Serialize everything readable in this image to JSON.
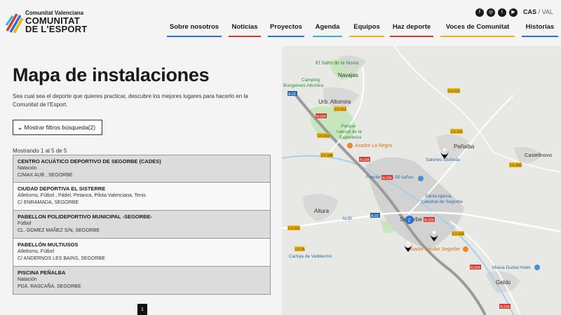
{
  "header": {
    "logo_small": "Comunitat Valenciana",
    "logo_line1": "COMUNITAT",
    "logo_line2": "DE L'ESPORT",
    "lang_active": "CAS",
    "lang_sep": "/",
    "lang_other": "VAL",
    "socials": [
      "facebook-icon",
      "instagram-icon",
      "twitter-icon",
      "youtube-icon"
    ]
  },
  "nav": [
    {
      "label": "Sobre nosotros",
      "color": "#2a6fd6"
    },
    {
      "label": "Noticias",
      "color": "#d93a2f"
    },
    {
      "label": "Proyectos",
      "color": "#2a6fd6"
    },
    {
      "label": "Agenda",
      "color": "#2fb5c9"
    },
    {
      "label": "Equipos",
      "color": "#f0b400"
    },
    {
      "label": "Haz deporte",
      "color": "#d93a2f"
    },
    {
      "label": "Voces de Comunitat",
      "color": "#f0b400"
    },
    {
      "label": "Historias",
      "color": "#2a6fd6"
    }
  ],
  "page": {
    "title": "Mapa de instalaciones",
    "intro": "Sea cual sea el deporte que quieres practicar, descubre los mejores lugares para hacerlo en la Comunitat de l'Esport.",
    "filter_label": "Mostrar filtros búsqueda(2)",
    "showing": "Mostrando 1 al 5 de 5",
    "page_number": "1"
  },
  "results": [
    {
      "name": "CENTRO ACUÁTICO DEPORTIVO DE SEGORBE (CADES)",
      "sports": "Natación",
      "address": "C/MAX AUB , SEGORBE"
    },
    {
      "name": "CIUDAD DEPORTIVA EL SISTERRE",
      "sports": "Atletismo, Fútbol , Pádel, Petanca, Pilota Valenciana, Tenis",
      "address": "C/ ENRAMADA, SEGORBE"
    },
    {
      "name": "PABELLON POLIDEPORTIVO MUNICIPAL -SEGORBE-",
      "sports": "Fútbol",
      "address": "CL. GOMEZ MAÑEZ S/N, SEGORBE"
    },
    {
      "name": "PABELLÓN MULTIUSOS",
      "sports": "Atletismo, Fútbol",
      "address": "C/ ANDERNOS LES BAINS, SEGORBE"
    },
    {
      "name": "PISCINA PEÑALBA",
      "sports": "Natación",
      "address": "PDA. RASCAÑA, SEGORBE"
    }
  ],
  "map": {
    "places": {
      "salto": "El Salto de la Novia",
      "navajas": "Navajas",
      "camping1": "Camping",
      "camping2": "Bungalows Altomira",
      "urb1": "Urb. Altomira",
      "parque1": "Parque",
      "parque2": "natural de la",
      "parque3": "Esperanza",
      "asador_negra": "Asador La Negra",
      "penalba": "Peñalba",
      "castellnovo": "Castellnovo",
      "salones": "Salones Idubeda",
      "fuente": "Fuente de los 50 caños",
      "iglesia1": "Santa Iglesia",
      "iglesia2": "Catedral de Segorbe",
      "altura": "Altura",
      "albi": "ALBI",
      "segorbe": "Segorbe",
      "asador_aguilar": "Asador Aguilar Segorbe",
      "cartuja": "Cartuja de Valldecrist",
      "masia": "Masía Durba Hotel",
      "geldo": "Geldo"
    },
    "road_labels": {
      "a23a": "A-23",
      "cv213a": "CV-213",
      "n234a": "N-234",
      "cv215a": "CV-215",
      "cv213b": "CV-213",
      "cv215b": "CV-215",
      "cv245": "CV-245",
      "n234b": "N-234",
      "n234c": "N-234",
      "a23b": "A-23",
      "cv241": "CV-241",
      "cv200": "CV-200",
      "n234d": "N-234",
      "cv25": "CV-25",
      "cv200b": "CV-200",
      "n234e": "N-234",
      "n234f": "N-234"
    },
    "cluster_count": "2",
    "colors": {
      "water": "#9ec9e8",
      "park": "#bfe3b4",
      "urban": "#d5d5d5",
      "road": "#ffffff",
      "highway": "#a8a8a8",
      "label_green": "#2e8b3e",
      "label_blue": "#2d6aa5",
      "label_orange": "#d9731a"
    }
  }
}
